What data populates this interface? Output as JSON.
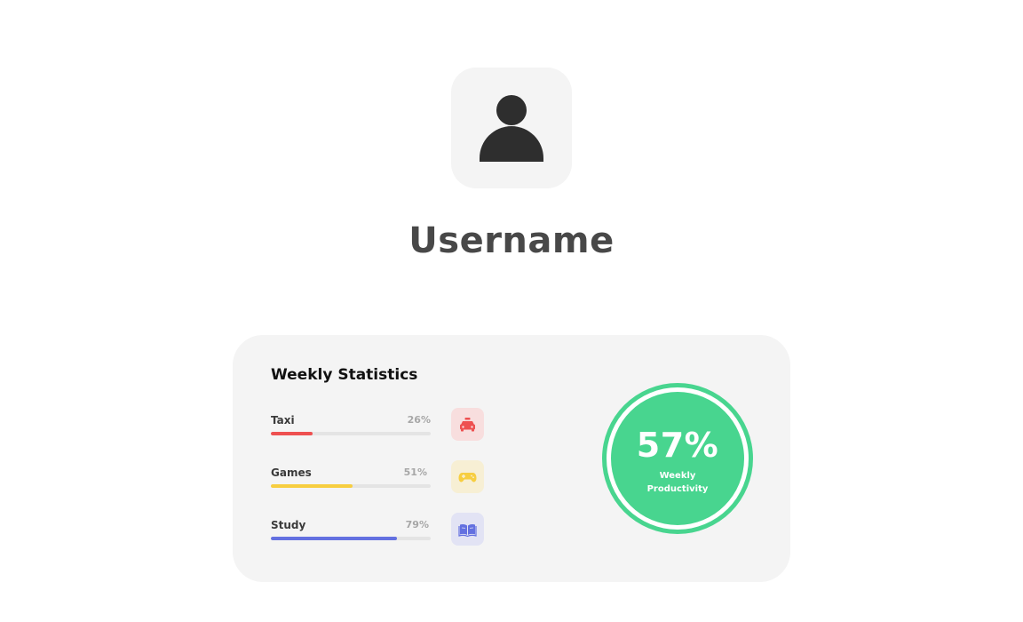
{
  "profile": {
    "username": "Username",
    "avatar_icon": "user-icon"
  },
  "stats_card": {
    "title": "Weekly Statistics",
    "items": [
      {
        "label": "Taxi",
        "percent_text": "26%",
        "progress": 0.26,
        "color": "#ee5050",
        "icon": "taxi-icon",
        "icon_bg": "#f8dede"
      },
      {
        "label": "Games",
        "percent_text": "51%",
        "progress": 0.51,
        "color": "#f7ce40",
        "icon": "gamepad-icon",
        "icon_bg": "#f7efd4"
      },
      {
        "label": "Study",
        "percent_text": "79%",
        "progress": 0.79,
        "color": "#6370e0",
        "icon": "book-icon",
        "icon_bg": "#e2e3f4"
      }
    ]
  },
  "productivity": {
    "value": "57%",
    "label": "Weekly Productivity",
    "color": "#48d58f"
  }
}
